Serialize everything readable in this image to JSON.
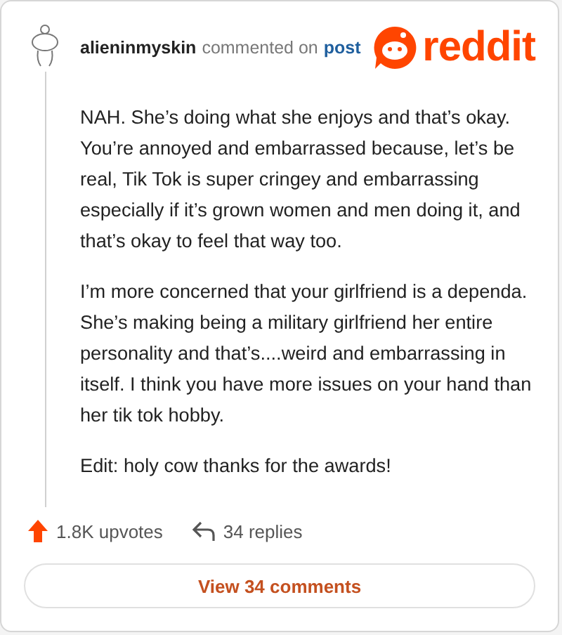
{
  "comment": {
    "author": "alieninmyskin",
    "action": "commented on",
    "target": "post",
    "paragraphs": [
      "NAH. She’s doing what she enjoys and that’s okay. You’re annoyed and embarrassed because, let’s be real, Tik Tok is super cringey and embarrassing especially if it’s grown women and men doing it, and that’s okay to feel that way too.",
      "I’m more concerned that your girlfriend is a dependa. She’s making being a military girlfriend her entire personality and that’s....weird and embarrassing in itself. I think you have more issues on your hand than her tik tok hobby.",
      "Edit: holy cow thanks for the awards!"
    ]
  },
  "logo": {
    "wordmark": "reddit"
  },
  "footer": {
    "upvotes": "1.8K upvotes",
    "replies": "34 replies",
    "view_button": "View 34 comments"
  }
}
